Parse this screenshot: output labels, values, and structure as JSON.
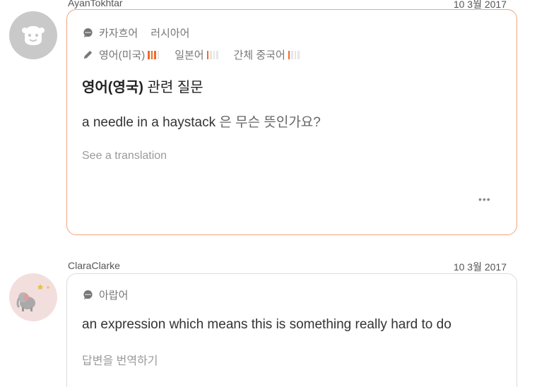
{
  "post1": {
    "username": "AyanTokhtar",
    "date": "10 3월 2017",
    "known_langs": [
      "카자흐어",
      "러시아어"
    ],
    "learning_langs": [
      {
        "name": "영어(미국)",
        "level": 3
      },
      {
        "name": "일본어",
        "level": 1
      },
      {
        "name": "간체 중국어",
        "level": 1
      }
    ],
    "title_bold": "영어(영국)",
    "title_rest": " 관련 질문",
    "question_en": "a needle in a haystack",
    "question_ko": " 은 무슨 뜻인가요?",
    "see_translation": "See a translation",
    "more_label": "•••"
  },
  "post2": {
    "username": "ClaraClarke",
    "date": "10 3월 2017",
    "known_langs": [
      "아랍어"
    ],
    "answer": "an expression which means this is something really hard to do",
    "translate_answer": "답변을 번역하기"
  },
  "colors": {
    "accent": "#f06b29",
    "card_border": "#f1a47e"
  }
}
